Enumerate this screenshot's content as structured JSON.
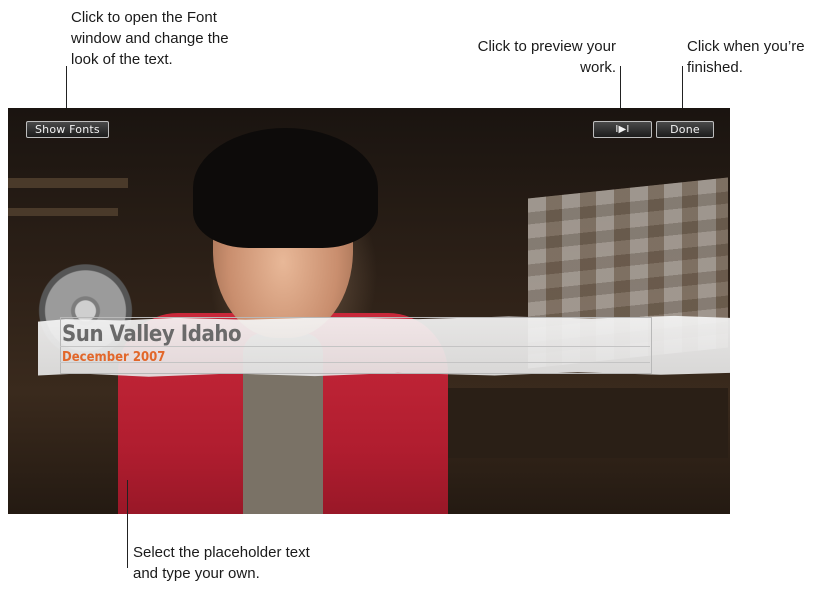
{
  "callouts": {
    "fonts": [
      "Click to open the Font",
      "window and change the",
      "look of the text."
    ],
    "preview": [
      "Click to preview your",
      "work."
    ],
    "done": [
      "Click when you’re",
      "finished."
    ],
    "placeholder": [
      "Select the placeholder text",
      "and type your own."
    ]
  },
  "toolbar": {
    "show_fonts_label": "Show Fonts",
    "play_label": "I▶I",
    "done_label": "Done"
  },
  "title_overlay": {
    "main_text": "Sun Valley Idaho",
    "sub_text": "December 2007"
  },
  "colors": {
    "title_main": "#6a6a6a",
    "title_sub": "#e2672a"
  }
}
